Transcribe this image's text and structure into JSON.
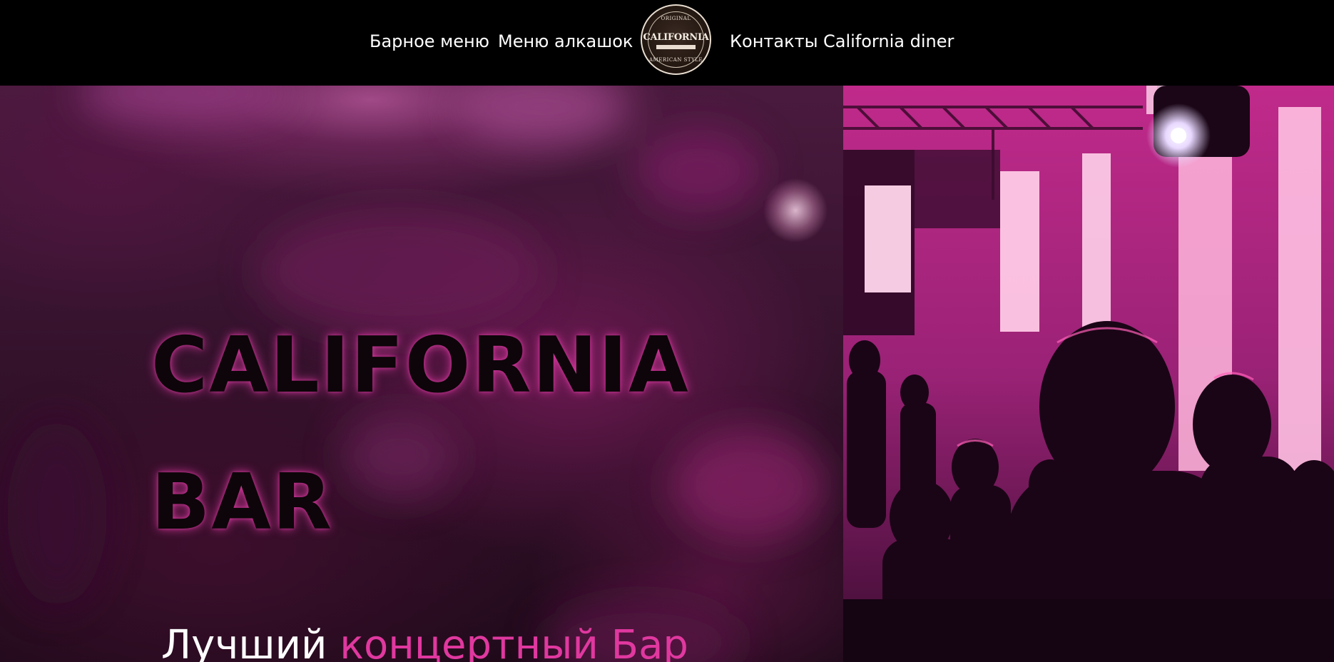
{
  "nav": {
    "links_left": [
      "Барное меню",
      "Меню алкашок"
    ],
    "links_right": [
      "Контакты",
      "California diner"
    ],
    "logo": {
      "icon": "california-bar-logo-icon",
      "top_text": "ORIGINAL",
      "main_text": "CALIFORNIA",
      "bottom_text": "AMERICAN STYLE"
    }
  },
  "hero": {
    "title_line1": "CALIFORNIA",
    "title_line2": "BAR",
    "subtitle_white": "Лучший",
    "subtitle_pink": "концертный Бар",
    "photo_icon": "concert-photo-icon"
  },
  "colors": {
    "accent_pink": "#e0389f",
    "nav_background": "#000000",
    "title_glow": "#e63caa"
  }
}
